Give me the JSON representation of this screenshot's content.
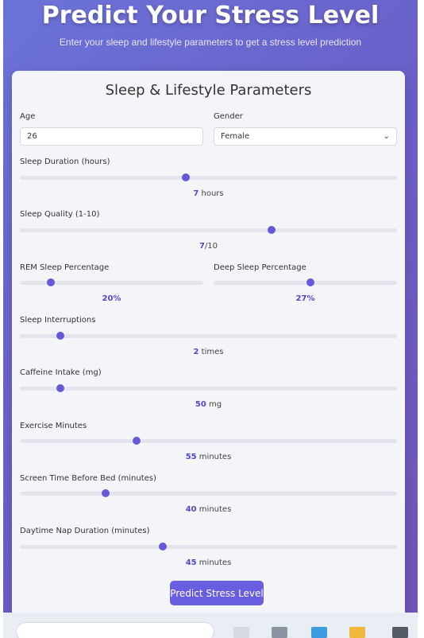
{
  "header": {
    "title": "Predict Your Stress Level",
    "subtitle": "Enter your sleep and lifestyle parameters to get a stress level prediction"
  },
  "form": {
    "title": "Sleep & Lifestyle Parameters",
    "age": {
      "label": "Age",
      "value": "26"
    },
    "gender": {
      "label": "Gender",
      "value": "Female"
    },
    "sleep_duration": {
      "label": "Sleep Duration (hours)",
      "value": "7",
      "unit": " hours",
      "fraction": 0.44
    },
    "sleep_quality": {
      "label": "Sleep Quality (1-10)",
      "value": "7",
      "unit": "/10",
      "fraction": 0.667
    },
    "rem_sleep": {
      "label": "REM Sleep Percentage",
      "value": "20",
      "unit": "%",
      "fraction": 0.17
    },
    "deep_sleep": {
      "label": "Deep Sleep Percentage",
      "value": "27",
      "unit": "%",
      "fraction": 0.53
    },
    "interruptions": {
      "label": "Sleep Interruptions",
      "value": "2",
      "unit": " times",
      "fraction": 0.107
    },
    "caffeine": {
      "label": "Caffeine Intake (mg)",
      "value": "50",
      "unit": " mg",
      "fraction": 0.107
    },
    "exercise": {
      "label": "Exercise Minutes",
      "value": "55",
      "unit": " minutes",
      "fraction": 0.31
    },
    "screen_time": {
      "label": "Screen Time Before Bed (minutes)",
      "value": "40",
      "unit": " minutes",
      "fraction": 0.228
    },
    "nap": {
      "label": "Daytime Nap Duration (minutes)",
      "value": "45",
      "unit": " minutes",
      "fraction": 0.378
    },
    "submit_label": "Predict Stress Level"
  },
  "colors": {
    "accent": "#6559d8",
    "background_top": "#6b73d8",
    "background_bottom": "#7255b8"
  },
  "taskbar": {
    "icons": [
      "search-icon",
      "app-icon",
      "mail-icon",
      "folder-icon",
      "terminal-icon"
    ]
  }
}
